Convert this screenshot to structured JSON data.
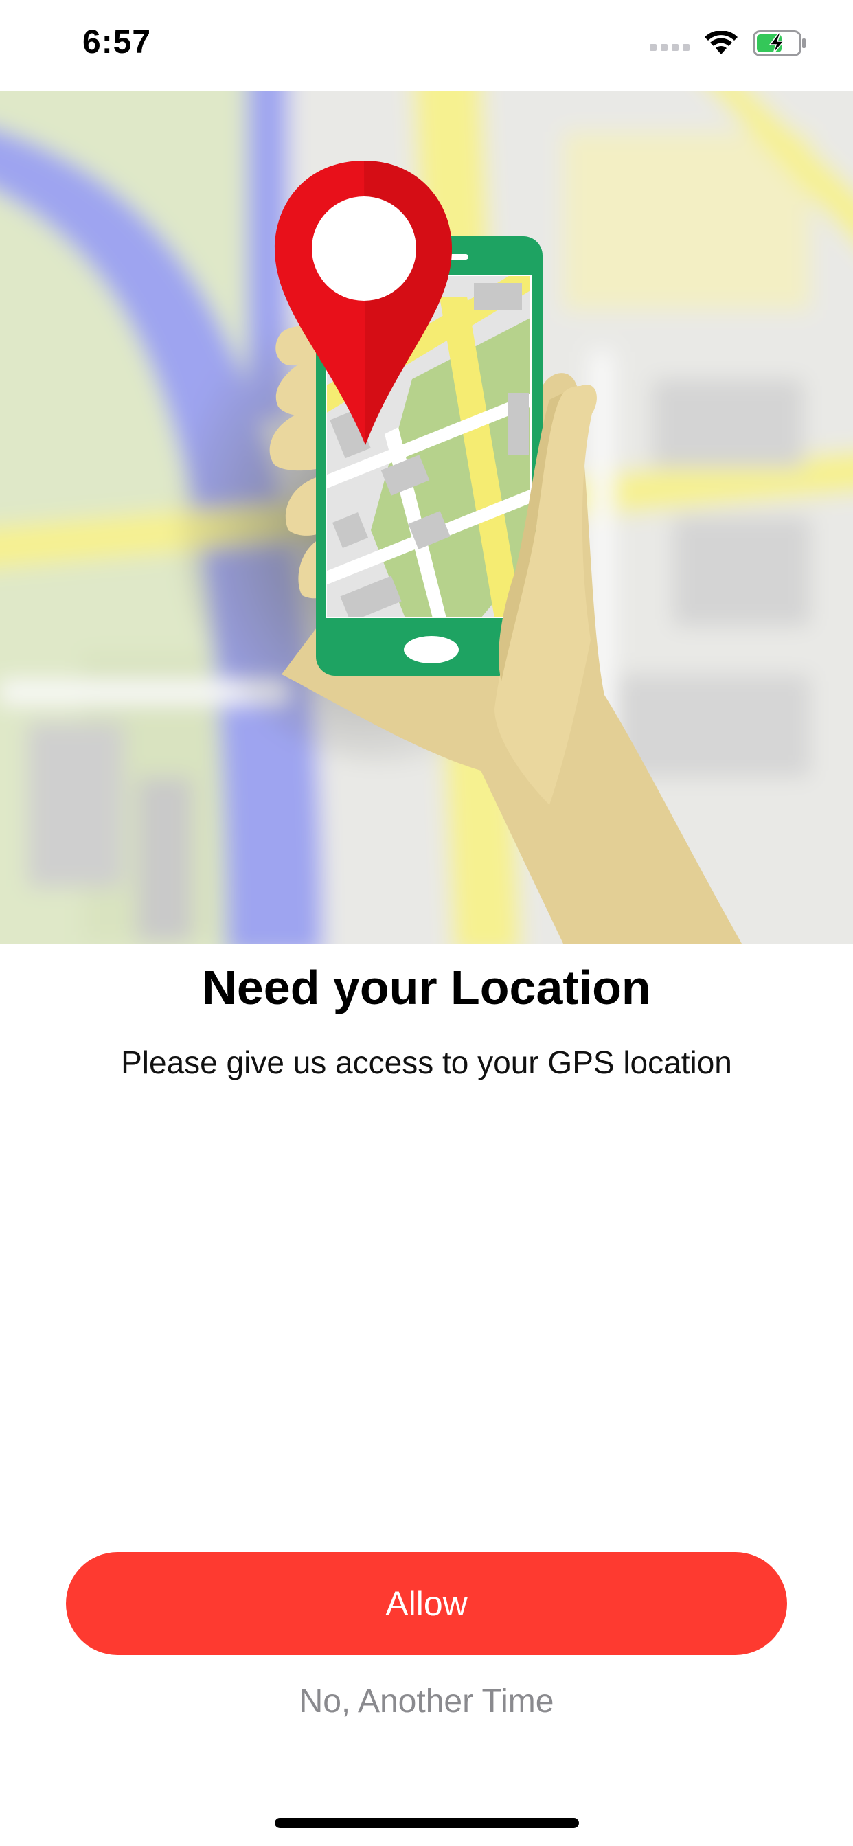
{
  "status_bar": {
    "time": "6:57",
    "icons": [
      "cellular-signal-icon",
      "wifi-icon",
      "battery-charging-icon"
    ]
  },
  "hero": {
    "illustration": "hand-holding-phone-with-map-pin",
    "icons": [
      "map-pin-icon",
      "smartphone-icon"
    ]
  },
  "content": {
    "title": "Need your Location",
    "subtitle": "Please give us access to your GPS location"
  },
  "actions": {
    "allow_label": "Allow",
    "decline_label": "No, Another Time"
  },
  "colors": {
    "accent": "#fe3a30",
    "pin": "#e8101a",
    "phone": "#1ea362",
    "battery": "#34c759",
    "secondary_text": "#8a8a8e"
  }
}
